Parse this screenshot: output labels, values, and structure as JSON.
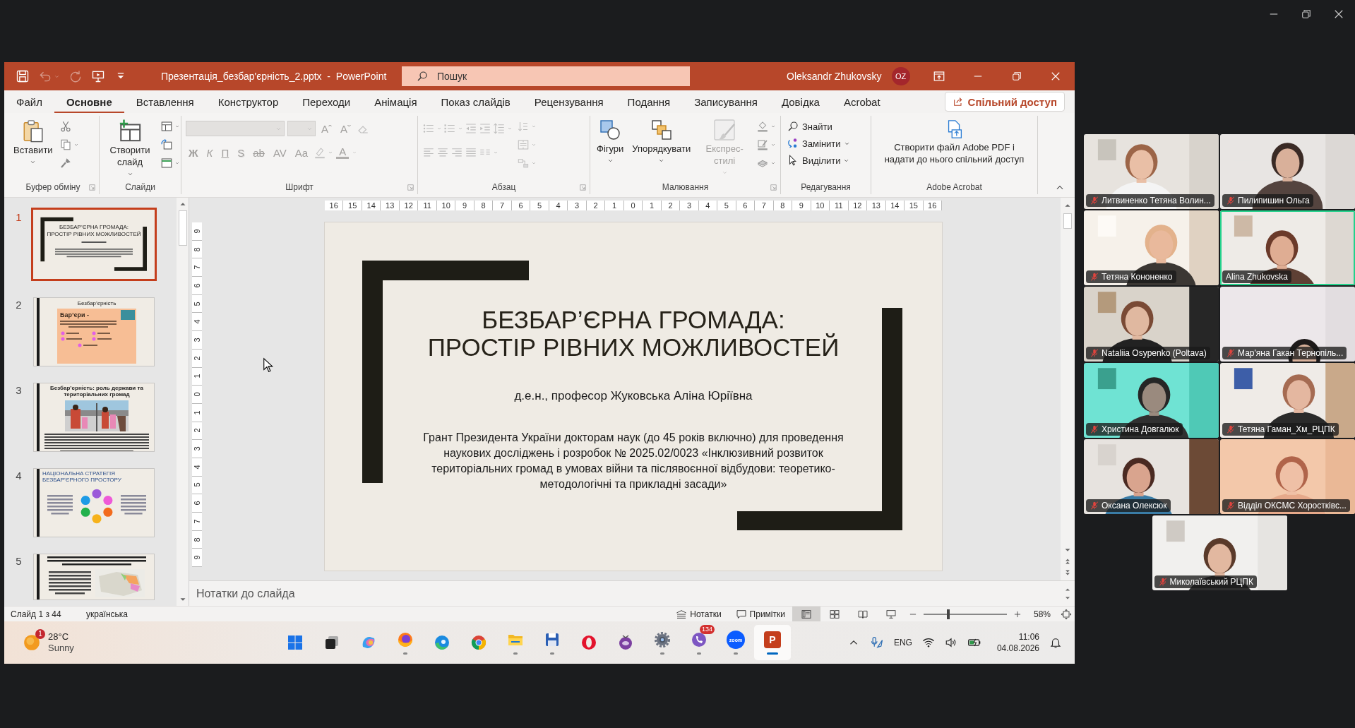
{
  "titlebar": {
    "quick_access": [
      {
        "disabled": false
      },
      {
        "disabled": true
      },
      {
        "disabled": true
      },
      {
        "disabled": false
      },
      {
        "disabled": false
      }
    ],
    "title": "Презентація_безбар'єрність_2.pptx  -  PowerPoint",
    "search": {
      "placeholder": "Пошук"
    },
    "user_name": "Oleksandr Zhukovsky",
    "user_initials": "OZ"
  },
  "tabs": [
    {
      "label": "Файл",
      "selected": false
    },
    {
      "label": "Основне",
      "selected": true
    },
    {
      "label": "Вставлення",
      "selected": false
    },
    {
      "label": "Конструктор",
      "selected": false
    },
    {
      "label": "Переходи",
      "selected": false
    },
    {
      "label": "Анімація",
      "selected": false
    },
    {
      "label": "Показ слайдів",
      "selected": false
    },
    {
      "label": "Рецензування",
      "selected": false
    },
    {
      "label": "Подання",
      "selected": false
    },
    {
      "label": "Записування",
      "selected": false
    },
    {
      "label": "Довідка",
      "selected": false
    },
    {
      "label": "Acrobat",
      "selected": false
    }
  ],
  "share_button": {
    "label": "Спільний доступ"
  },
  "ribbon": {
    "groups": [
      {
        "kind": "clipboard",
        "label": "Буфер обміну",
        "launcher": true,
        "buttons": [
          {
            "label": "Вставити",
            "dropdown": true
          }
        ]
      },
      {
        "kind": "slides",
        "label": "Слайди",
        "buttons": [
          {
            "label": "Створити слайд",
            "dropdown": true
          }
        ]
      },
      {
        "kind": "font",
        "label": "Шрифт",
        "launcher": true,
        "disabled": true,
        "size_buttons": [
          "Aˆ",
          "Aˇ"
        ],
        "format_buttons": [
          "Ж",
          "К",
          "П",
          "S",
          "ab",
          "AV",
          "Aa"
        ],
        "color_button": "A"
      },
      {
        "kind": "paragraph",
        "label": "Абзац",
        "launcher": true,
        "disabled": true
      },
      {
        "kind": "drawing",
        "label": "Малювання",
        "launcher": true,
        "buttons": [
          {
            "label": "Фігури",
            "dropdown": true,
            "disabled": false
          },
          {
            "label": "Упорядкувати",
            "dropdown": true,
            "disabled": false
          },
          {
            "label": "Експрес-стилі",
            "dropdown": true,
            "disabled": true
          }
        ]
      },
      {
        "kind": "editing",
        "label": "Редагування",
        "buttons": [
          {
            "label": "Знайти",
            "dropdown": false
          },
          {
            "label": "Замінити",
            "dropdown": true
          },
          {
            "label": "Виділити",
            "dropdown": true
          }
        ]
      },
      {
        "kind": "acrobat",
        "label": "Adobe Acrobat",
        "buttons": [
          {
            "label": "Створити файл Adobe PDF і надати до нього спільний доступ"
          }
        ]
      }
    ]
  },
  "slides": [
    {
      "number": "1",
      "selected": true,
      "kind": "title",
      "title": "БЕЗБАР’ЄРНА ГРОМАДА:\nПРОСТІР РІВНИХ МОЖЛИВОСТЕЙ"
    },
    {
      "number": "2",
      "selected": false,
      "kind": "bullets",
      "title": "Безбар’єрність",
      "heading": "Бар’єри -"
    },
    {
      "number": "3",
      "selected": false,
      "kind": "illustration",
      "title": "Безбар’єрність: роль держави та територіальних громад"
    },
    {
      "number": "4",
      "selected": false,
      "kind": "diagram",
      "title": "НАЦІОНАЛЬНА СТРАТЕГІЯ БЕЗБАР’ЄРНОГО ПРОСТОРУ"
    },
    {
      "number": "5",
      "selected": false,
      "kind": "map"
    }
  ],
  "ruler": {
    "horizontal": [
      "16",
      "15",
      "14",
      "13",
      "12",
      "11",
      "10",
      "9",
      "8",
      "7",
      "6",
      "5",
      "4",
      "3",
      "2",
      "1",
      "0",
      "1",
      "2",
      "3",
      "4",
      "5",
      "6",
      "7",
      "8",
      "9",
      "10",
      "11",
      "12",
      "13",
      "14",
      "15",
      "16"
    ],
    "vertical": [
      "9",
      "8",
      "7",
      "6",
      "5",
      "4",
      "3",
      "2",
      "1",
      "0",
      "1",
      "2",
      "3",
      "4",
      "5",
      "6",
      "7",
      "8",
      "9"
    ]
  },
  "slide": {
    "title": "БЕЗБАР’ЄРНА ГРОМАДА:\nПРОСТІР РІВНИХ МОЖЛИВОСТЕЙ",
    "subtitle": "д.е.н., професор Жуковська Аліна Юріївна",
    "text": "Грант Президента України докторам наук (до 45 років включно) для проведення наукових досліджень і розробок № 2025.02/0023 «Інклюзивний розвиток територіальних громад в умовах війни та післявоєнної відбудови: теоретико-методологічні та прикладні засади»"
  },
  "notes": {
    "placeholder": "Нотатки до слайда"
  },
  "status_bar": {
    "slide_position": "Слайд 1 з 44",
    "language": "українська",
    "notes_button": "Нотатки",
    "comments_button": "Примітки",
    "views": [
      {
        "selected": true
      },
      {
        "selected": false
      },
      {
        "selected": false
      },
      {
        "selected": false
      }
    ],
    "zoom": {
      "level": 0.3,
      "reading": "58%"
    }
  },
  "taskbar": {
    "weather": {
      "badge": "1",
      "temperature": "28°C",
      "condition": "Sunny"
    },
    "apps": [
      {
        "running": false,
        "active": false
      },
      {
        "running": false,
        "active": false
      },
      {
        "running": false,
        "active": false
      },
      {
        "running": true,
        "active": false
      },
      {
        "running": false,
        "active": false
      },
      {
        "running": false,
        "active": false
      },
      {
        "running": true,
        "active": false
      },
      {
        "running": true,
        "active": false
      },
      {
        "running": false,
        "active": false
      },
      {
        "running": false,
        "active": false
      },
      {
        "running": true,
        "active": false
      },
      {
        "running": true,
        "active": false,
        "badge": "134"
      },
      {
        "running": true,
        "active": false,
        "label": "zoom"
      },
      {
        "running": true,
        "active": true,
        "label": "P"
      }
    ],
    "tray": {
      "language": "ENG",
      "time": "11:06",
      "date": "04.08.2026"
    }
  },
  "participants": [
    {
      "name": "Литвиненко Тетяна Волин...",
      "muted": true,
      "speaking": false
    },
    {
      "name": "Пилипишин Ольга",
      "muted": true,
      "speaking": false
    },
    {
      "name": "Тетяна Кононенко",
      "muted": true,
      "speaking": false
    },
    {
      "name": "Alina Zhukovska",
      "muted": false,
      "speaking": true
    },
    {
      "name": "Nataliia Osypenko (Poltava)",
      "muted": true,
      "speaking": false
    },
    {
      "name": "Мар'яна Гакан Тернопіль...",
      "muted": true,
      "speaking": false
    },
    {
      "name": "Христина Довгалюк",
      "muted": true,
      "speaking": false
    },
    {
      "name": "Тетяна Гаман_Хм_РЦПК",
      "muted": true,
      "speaking": false
    },
    {
      "name": "Оксана Олексюк",
      "muted": true,
      "speaking": false
    },
    {
      "name": "Відділ ОКСМС Хоростківс...",
      "muted": true,
      "speaking": false
    },
    {
      "name": "Миколаївський РЦПК",
      "muted": true,
      "speaking": false
    }
  ]
}
